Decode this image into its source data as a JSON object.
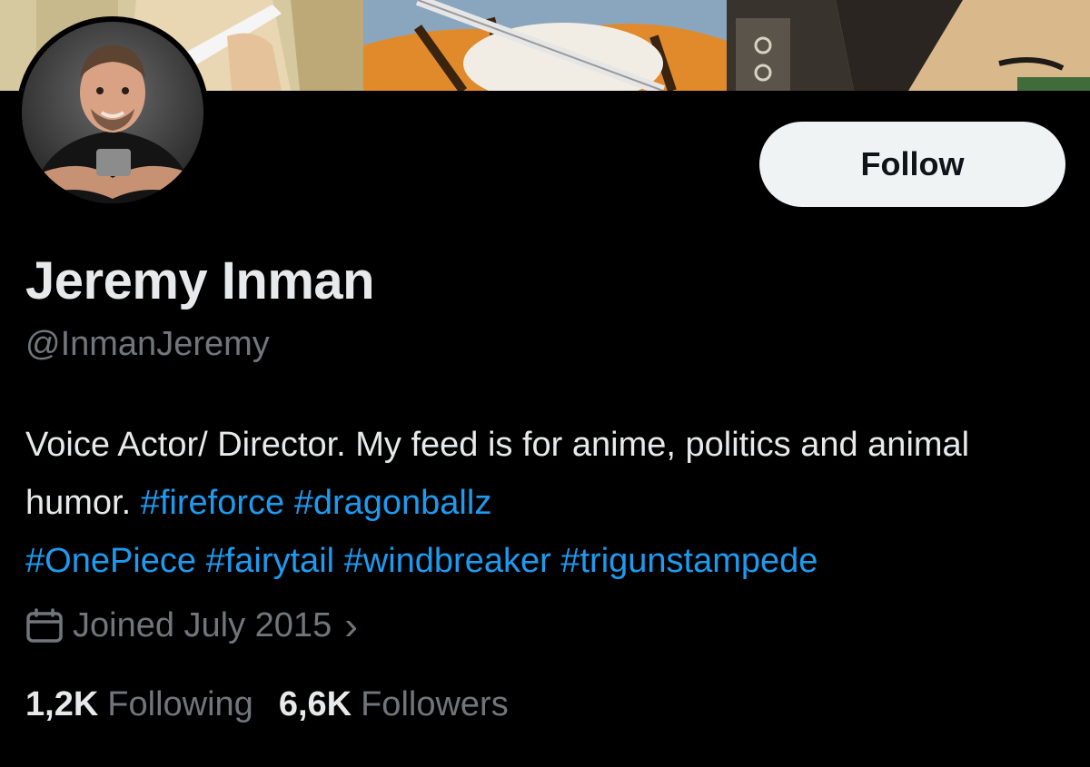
{
  "profile": {
    "name": "Jeremy Inman",
    "handle": "@InmanJeremy",
    "bio_text": "Voice Actor/ Director. My feed is for anime, politics and animal humor.",
    "hashtags": [
      "#fireforce",
      "#dragonballz",
      "#OnePiece",
      "#fairytail",
      "#windbreaker",
      "#trigunstampede"
    ],
    "joined": "Joined July 2015",
    "joined_chevron": "›"
  },
  "actions": {
    "follow_label": "Follow"
  },
  "stats": {
    "following_count": "1,2K",
    "following_label": "Following",
    "followers_count": "6,6K",
    "followers_label": "Followers"
  },
  "colors": {
    "background": "#000000",
    "text_primary": "#e7e9ea",
    "text_secondary": "#71767b",
    "link": "#1d9bf0",
    "button_bg": "#eff3f4"
  },
  "icons": {
    "joined": "calendar-icon",
    "more": "chevron-right-icon"
  }
}
